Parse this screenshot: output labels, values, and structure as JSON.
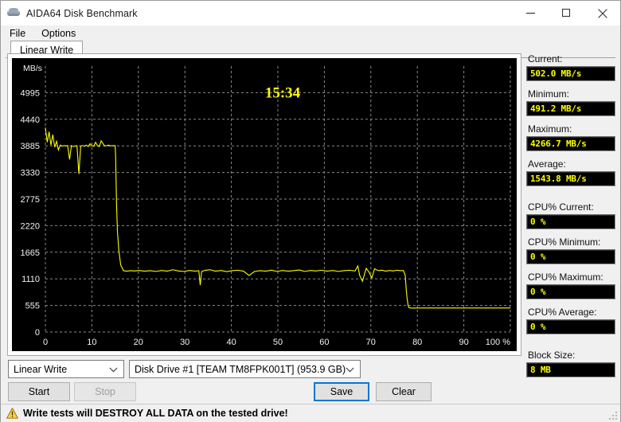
{
  "window": {
    "title": "AIDA64 Disk Benchmark",
    "icon": "disk-icon",
    "minimize_label": "—",
    "maximize_label": "□",
    "close_label": "✕"
  },
  "menu": {
    "items": [
      {
        "label": "File"
      },
      {
        "label": "Options"
      }
    ]
  },
  "tabs": [
    {
      "label": "Linear Write",
      "active": true
    }
  ],
  "chart_data": {
    "type": "line",
    "title": "",
    "xlabel": "%",
    "ylabel": "MB/s",
    "timer": "15:34",
    "xlim": [
      0,
      100
    ],
    "ylim": [
      0,
      5550
    ],
    "grid": true,
    "legend": "none",
    "line_color": "#ffff00",
    "background": "#000000",
    "axis_text_color": "#f2f2f2",
    "grid_color": "#8a8a8a",
    "xticks": [
      0,
      10,
      20,
      30,
      40,
      50,
      60,
      70,
      80,
      90,
      100
    ],
    "xtick_labels": [
      "0",
      "10",
      "20",
      "30",
      "40",
      "50",
      "60",
      "70",
      "80",
      "90",
      "100 %"
    ],
    "yticks": [
      0,
      555,
      1110,
      1665,
      2220,
      2775,
      3330,
      3885,
      4440,
      4995
    ],
    "ytick_labels": [
      "0",
      "555",
      "1110",
      "1665",
      "2220",
      "2775",
      "3330",
      "3885",
      "4440",
      "4995"
    ],
    "series": [
      {
        "name": "Linear Write",
        "x": [
          0.0,
          0.4,
          0.8,
          1.2,
          1.6,
          2.0,
          2.4,
          2.8,
          3.2,
          3.6,
          4.0,
          4.4,
          4.8,
          5.2,
          5.6,
          6.0,
          6.4,
          6.8,
          7.2,
          7.6,
          8.0,
          8.4,
          8.8,
          9.2,
          9.6,
          10.0,
          10.4,
          10.8,
          11.2,
          11.6,
          12.0,
          12.4,
          12.8,
          13.2,
          13.6,
          14.0,
          14.4,
          14.8,
          15.0,
          15.1,
          15.2,
          15.3,
          15.5,
          15.8,
          16.2,
          16.8,
          17.5,
          18.3,
          19.2,
          20.2,
          21.3,
          22.5,
          23.8,
          25.0,
          26.2,
          27.4,
          28.6,
          29.8,
          31.0,
          32.2,
          33.0,
          33.3,
          33.6,
          34.2,
          35.4,
          36.6,
          37.8,
          39.0,
          40.2,
          41.4,
          42.6,
          43.8,
          45.0,
          46.2,
          47.4,
          48.6,
          49.8,
          51.0,
          52.2,
          53.4,
          54.6,
          55.8,
          57.0,
          58.2,
          59.4,
          60.6,
          61.8,
          63.0,
          64.2,
          65.4,
          66.6,
          67.2,
          67.6,
          68.2,
          69.0,
          69.6,
          70.2,
          70.8,
          71.6,
          72.4,
          73.2,
          74.0,
          74.8,
          75.6,
          76.4,
          77.0,
          77.4,
          77.6,
          77.8,
          78.0,
          78.2,
          78.5,
          79.0,
          80.0,
          82.0,
          84.0,
          86.0,
          88.0,
          90.0,
          92.0,
          94.0,
          96.0,
          98.0,
          100.0
        ],
        "y": [
          4266,
          3960,
          4180,
          3900,
          4120,
          3860,
          3980,
          3800,
          3900,
          3880,
          3890,
          3885,
          3890,
          3600,
          3890,
          3870,
          3880,
          3890,
          3300,
          3885,
          3890,
          3880,
          3900,
          3870,
          3930,
          3885,
          3880,
          3960,
          3890,
          3870,
          3990,
          3930,
          3880,
          3890,
          3900,
          3885,
          3890,
          3890,
          3890,
          3700,
          3200,
          2700,
          2100,
          1700,
          1400,
          1280,
          1270,
          1280,
          1275,
          1285,
          1270,
          1280,
          1265,
          1285,
          1270,
          1300,
          1275,
          1265,
          1285,
          1270,
          1280,
          980,
          1260,
          1285,
          1300,
          1270,
          1285,
          1260,
          1280,
          1290,
          1270,
          1180,
          1265,
          1280,
          1270,
          1290,
          1265,
          1285,
          1270,
          1280,
          1295,
          1265,
          1285,
          1275,
          1290,
          1270,
          1285,
          1265,
          1280,
          1290,
          1275,
          1380,
          1180,
          1060,
          1330,
          1250,
          1130,
          1320,
          1280,
          1290,
          1270,
          1285,
          1275,
          1290,
          1280,
          1285,
          1180,
          900,
          700,
          560,
          510,
          502,
          500,
          502,
          502,
          502,
          502,
          502,
          502,
          502,
          502,
          502,
          502,
          502
        ]
      }
    ]
  },
  "sidebar": {
    "stats": [
      {
        "label": "Current:",
        "value": "502.0 MB/s",
        "name": "current"
      },
      {
        "label": "Minimum:",
        "value": "491.2 MB/s",
        "name": "minimum"
      },
      {
        "label": "Maximum:",
        "value": "4266.7 MB/s",
        "name": "maximum"
      },
      {
        "label": "Average:",
        "value": "1543.8 MB/s",
        "name": "average"
      },
      {
        "label": "CPU% Current:",
        "value": "0 %",
        "name": "cpu-current"
      },
      {
        "label": "CPU% Minimum:",
        "value": "0 %",
        "name": "cpu-minimum"
      },
      {
        "label": "CPU% Maximum:",
        "value": "0 %",
        "name": "cpu-maximum"
      },
      {
        "label": "CPU% Average:",
        "value": "0 %",
        "name": "cpu-average"
      },
      {
        "label": "Block Size:",
        "value": "8 MB",
        "name": "block-size"
      }
    ]
  },
  "controls": {
    "mode_combo": {
      "value": "Linear Write"
    },
    "drive_combo": {
      "value": "Disk Drive #1  [TEAM TM8FPK001T]  (953.9 GB)"
    },
    "start_button": "Start",
    "stop_button": "Stop",
    "save_button": "Save",
    "clear_button": "Clear"
  },
  "warning": {
    "icon": "warning-triangle-icon",
    "text": "Write tests will DESTROY ALL DATA on the tested drive!"
  }
}
